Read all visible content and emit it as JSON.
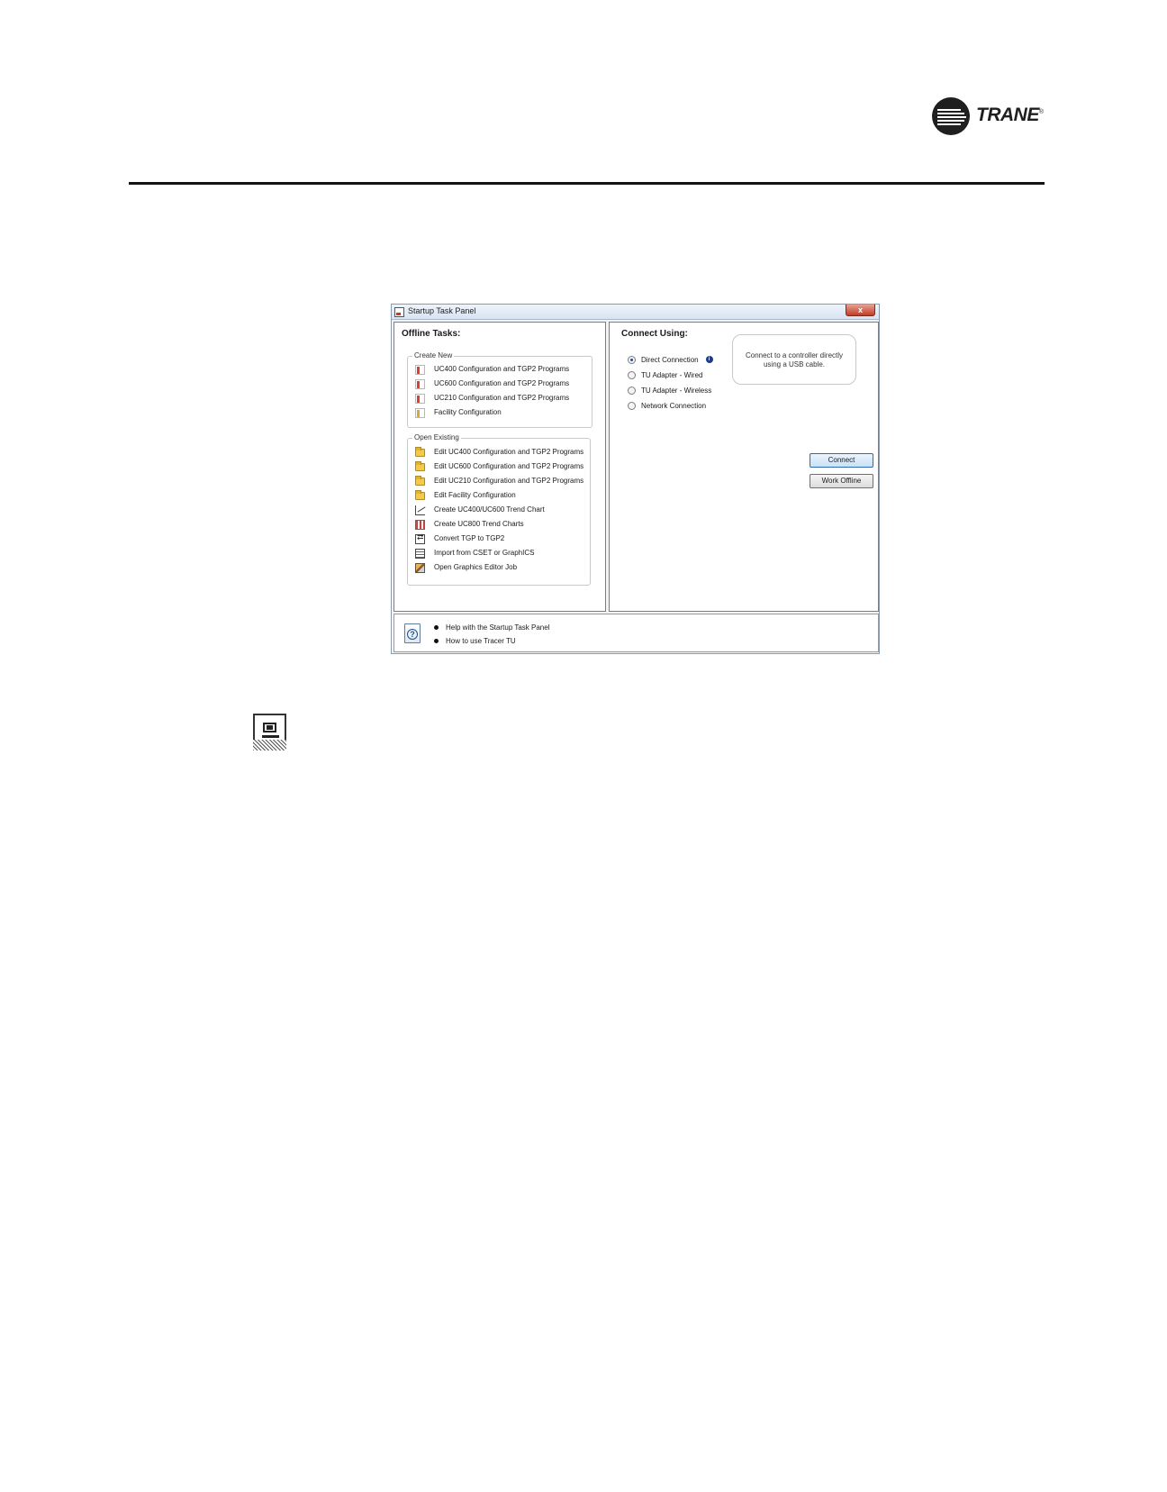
{
  "page": {
    "brand": "TRANE",
    "brand_mark": "®"
  },
  "window": {
    "title": "Startup Task Panel",
    "close_label": "x",
    "offline": {
      "heading": "Offline Tasks:",
      "create_new": {
        "legend": "Create New",
        "items": [
          {
            "label": "UC400 Configuration and TGP2 Programs",
            "icon": "new-document-icon"
          },
          {
            "label": "UC600 Configuration and TGP2 Programs",
            "icon": "new-document-icon"
          },
          {
            "label": "UC210 Configuration and TGP2 Programs",
            "icon": "new-document-icon"
          },
          {
            "label": "Facility Configuration",
            "icon": "new-document-icon"
          }
        ]
      },
      "open_existing": {
        "legend": "Open Existing",
        "items": [
          {
            "label": "Edit UC400 Configuration and TGP2 Programs",
            "icon": "folder-icon"
          },
          {
            "label": "Edit UC600 Configuration and TGP2 Programs",
            "icon": "folder-icon"
          },
          {
            "label": "Edit UC210 Configuration and TGP2 Programs",
            "icon": "folder-icon"
          },
          {
            "label": "Edit Facility Configuration",
            "icon": "folder-icon"
          },
          {
            "label": "Create UC400/UC600 Trend Chart",
            "icon": "trend-line-icon"
          },
          {
            "label": "Create UC800 Trend Charts",
            "icon": "trend-chart-icon"
          },
          {
            "label": "Convert TGP to TGP2",
            "icon": "convert-icon"
          },
          {
            "label": "Import from CSET or GraphICS",
            "icon": "import-icon"
          },
          {
            "label": "Open Graphics Editor Job",
            "icon": "graphics-editor-icon"
          }
        ]
      }
    },
    "connect": {
      "heading": "Connect Using:",
      "options": [
        {
          "label": "Direct Connection",
          "checked": true
        },
        {
          "label": "TU Adapter - Wired",
          "checked": false
        },
        {
          "label": "TU Adapter - Wireless",
          "checked": false
        },
        {
          "label": "Network Connection",
          "checked": false
        }
      ],
      "info_glyph": "i",
      "hint": "Connect to a controller directly using a USB cable.",
      "connect_button": "Connect",
      "offline_button": "Work Offline"
    },
    "help": {
      "icon_glyph": "?",
      "links": [
        "Help with the Startup Task Panel",
        "How to use Tracer TU"
      ]
    }
  },
  "colors": {
    "accent": "#2f6cb3",
    "folder": "#f2c94c",
    "titlebar_close": "#c23c25"
  }
}
